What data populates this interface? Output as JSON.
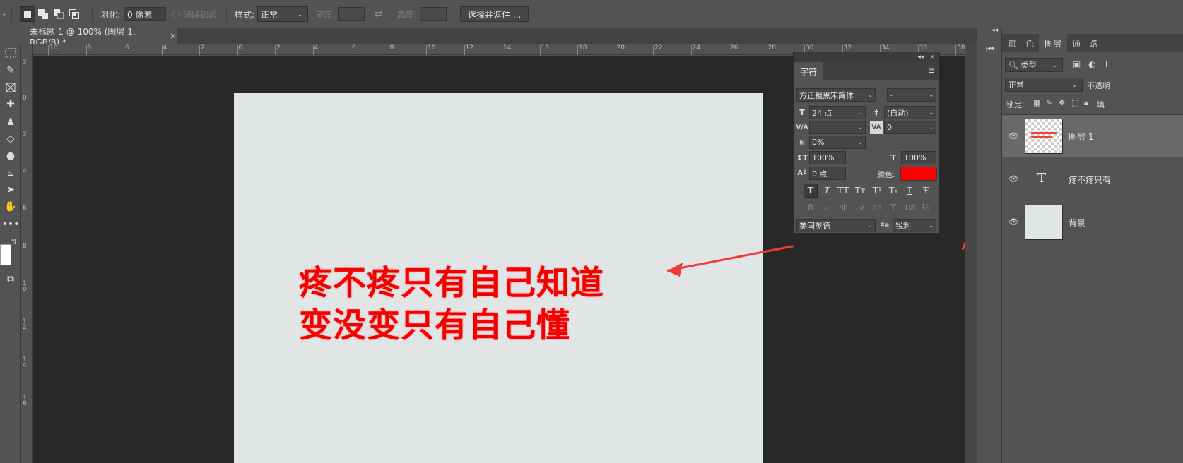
{
  "options_bar": {
    "feather_label": "羽化:",
    "feather_value": "0 像素",
    "antialias_label": "消除锯齿",
    "style_label": "样式:",
    "style_value": "正常",
    "width_label": "宽度:",
    "height_label": "高度:",
    "select_mask_button": "选择并遮住 ..."
  },
  "document_tab": {
    "title": "未标题-1 @ 100% (图层 1, RGB/8) *",
    "close": "×"
  },
  "ruler": {
    "h_ticks": [
      "10",
      "8",
      "6",
      "4",
      "2",
      "0",
      "2",
      "4",
      "6",
      "8",
      "10",
      "12",
      "14",
      "16",
      "18",
      "20",
      "22",
      "24",
      "26",
      "28",
      "30",
      "32",
      "34",
      "36",
      "38"
    ],
    "v_ticks": [
      "2",
      "0",
      "2",
      "4",
      "6",
      "8",
      "1 0",
      "1 2",
      "1 4",
      "1 6"
    ]
  },
  "canvas": {
    "line1": "疼不疼只有自己知道",
    "line2": "变没变只有自己懂",
    "text_color": "#f30000"
  },
  "character_panel": {
    "tab": "字符",
    "collapse": "◂◂",
    "close": "×",
    "menu": "≡",
    "font_family": "方正粗黑宋简体",
    "font_style": "-",
    "font_size": "24 点",
    "leading": "(自动)",
    "kerning": "",
    "tracking": "0",
    "tsume": "0%",
    "vertical_scale": "100%",
    "horizontal_scale": "100%",
    "baseline_shift": "0 点",
    "color_label": "颜色:",
    "color": "#ff0000",
    "style_buttons": [
      "T",
      "T",
      "TT",
      "Tт",
      "T¹",
      "T₁",
      "T",
      "Ŧ"
    ],
    "opentype_buttons": [
      "fi",
      "ℴ",
      "st",
      "𝒜",
      "aa",
      "T",
      "1st",
      "½"
    ],
    "language": "美国英语",
    "antialias_icon": "ªa",
    "antialias": "锐利"
  },
  "layers_panel": {
    "tabs": [
      "颜",
      "色",
      "图层",
      "通",
      "路"
    ],
    "filter_kind": "类型",
    "blend_mode": "正常",
    "opacity_label": "不透明",
    "lock_label": "锁定:",
    "fill_label": "填",
    "layers": [
      {
        "name": "图层 1",
        "type": "pixel",
        "selected": true
      },
      {
        "name": "疼不疼只有",
        "type": "text",
        "selected": false
      },
      {
        "name": "背景",
        "type": "background",
        "selected": false
      }
    ]
  },
  "accent_color": "#ef3b3b"
}
